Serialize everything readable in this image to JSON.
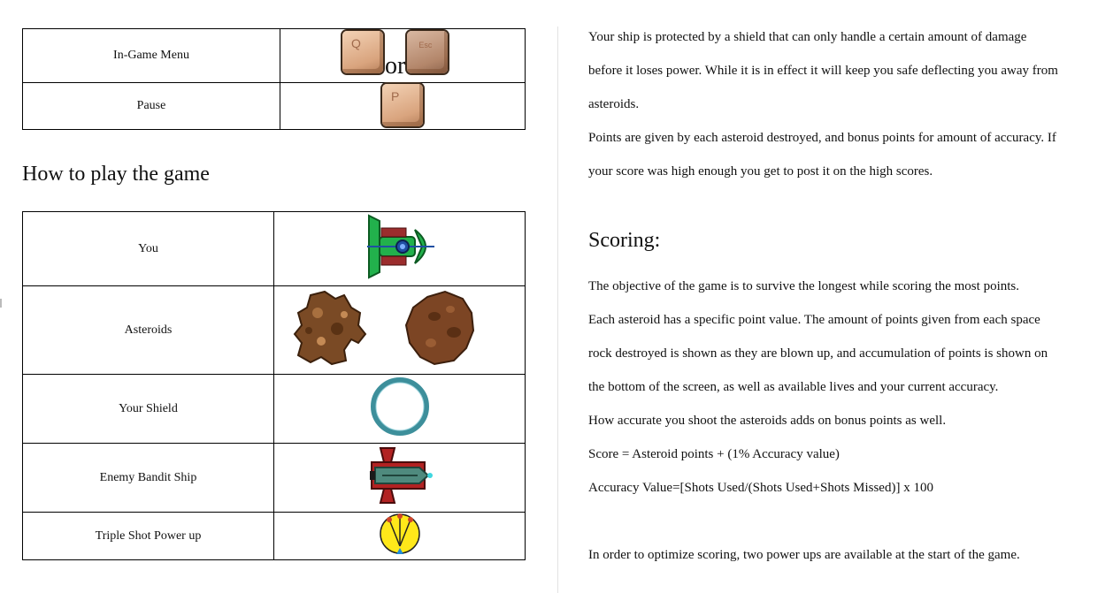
{
  "controls": {
    "rows": [
      {
        "label": "In-Game Menu",
        "key1": "Q",
        "separator": "or",
        "key2": "Esc"
      },
      {
        "label": "Pause",
        "key1": "P"
      }
    ]
  },
  "how_to_play": {
    "heading": "How to play the game",
    "rows": [
      {
        "label": "You"
      },
      {
        "label": "Asteroids"
      },
      {
        "label": "Your Shield"
      },
      {
        "label": "Enemy Bandit Ship"
      },
      {
        "label": "Triple Shot Power up"
      }
    ]
  },
  "right": {
    "shield_lines": [
      "Your ship is protected by a shield that can only handle a certain amount of damage",
      "before it loses power. While it is in effect it will keep you safe deflecting you away from",
      "asteroids."
    ],
    "points_lines": [
      "Points are given by each asteroid destroyed, and bonus points for amount of accuracy. If",
      "your score was high enough you get to post it on the high scores."
    ],
    "scoring_heading": "Scoring:",
    "scoring_lines": [
      "The objective of the game is to survive the longest while scoring the most points.",
      "Each asteroid has a specific point value. The amount of points given from each space",
      "rock destroyed is shown as they are blown up, and accumulation of points is shown on",
      "the bottom of the screen, as well as available lives and your current accuracy.",
      "How accurate you shoot the asteroids adds on bonus points as well.",
      "Score = Asteroid points + (1% Accuracy value)",
      "Accuracy Value=[Shots Used/(Shots Used+Shots Missed)] x 100"
    ],
    "optimize_line": "In order to optimize scoring, two power ups are available at the start of the game."
  },
  "colors": {
    "ship_green": "#22b14c",
    "shield_teal": "#3d8f9b",
    "asteroid_brown": "#6b3a1f",
    "powerup_yellow": "#ffe81a",
    "bandit_red": "#b22222"
  },
  "icons": [
    "q-key-icon",
    "esc-key-icon",
    "p-key-icon",
    "player-ship-icon",
    "asteroid-icon",
    "shield-ring-icon",
    "bandit-ship-icon",
    "triple-shot-icon"
  ]
}
